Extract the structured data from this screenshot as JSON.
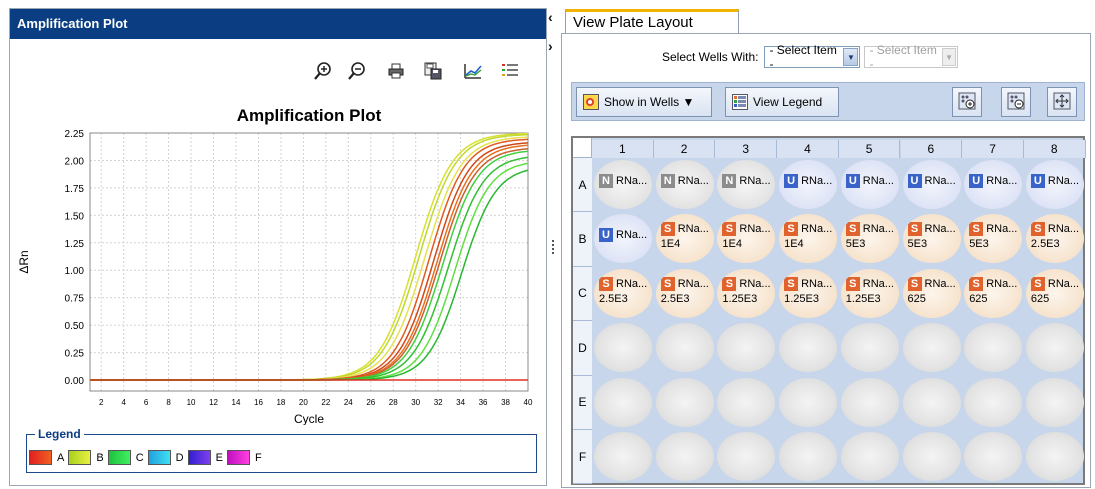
{
  "left_panel": {
    "title": "Amplification Plot",
    "toolbar_icons": [
      "zoom-in-icon",
      "zoom-out-icon",
      "print-icon",
      "save-icon",
      "plot-settings-icon",
      "legend-toggle-icon"
    ]
  },
  "legend": {
    "title": "Legend",
    "items": [
      {
        "label": "A",
        "color_from": "#e02020",
        "color_to": "#f06020"
      },
      {
        "label": "B",
        "color_from": "#a8d020",
        "color_to": "#e8f040"
      },
      {
        "label": "C",
        "color_from": "#20c040",
        "color_to": "#40f060"
      },
      {
        "label": "D",
        "color_from": "#20a0e0",
        "color_to": "#40e0f0"
      },
      {
        "label": "E",
        "color_from": "#3020d0",
        "color_to": "#8040f0"
      },
      {
        "label": "F",
        "color_from": "#c010c0",
        "color_to": "#ff40e0"
      }
    ]
  },
  "chart_data": {
    "type": "line",
    "title": "Amplification Plot",
    "xlabel": "Cycle",
    "ylabel": "ΔRn",
    "xlim": [
      1,
      40
    ],
    "ylim": [
      -0.1,
      2.25
    ],
    "x_ticks": [
      2,
      4,
      6,
      8,
      10,
      12,
      14,
      16,
      18,
      20,
      22,
      24,
      26,
      28,
      30,
      32,
      34,
      36,
      38,
      40
    ],
    "y_ticks": [
      "0.00",
      "0.25",
      "0.50",
      "0.75",
      "1.00",
      "1.25",
      "1.50",
      "1.75",
      "2.00",
      "2.25"
    ],
    "grid": true,
    "series": [
      {
        "color": "#d8e030",
        "midpoint": 30.0,
        "max": 2.25,
        "slope": 0.28
      },
      {
        "color": "#c0d830",
        "midpoint": 30.3,
        "max": 2.24,
        "slope": 0.28
      },
      {
        "color": "#e8e050",
        "midpoint": 30.8,
        "max": 2.22,
        "slope": 0.28
      },
      {
        "color": "#e05a20",
        "midpoint": 31.2,
        "max": 2.2,
        "slope": 0.29
      },
      {
        "color": "#d04818",
        "midpoint": 31.6,
        "max": 2.17,
        "slope": 0.29
      },
      {
        "color": "#e87020",
        "midpoint": 31.9,
        "max": 2.15,
        "slope": 0.29
      },
      {
        "color": "#c86030",
        "midpoint": 32.1,
        "max": 2.12,
        "slope": 0.29
      },
      {
        "color": "#40d040",
        "midpoint": 32.4,
        "max": 2.1,
        "slope": 0.29
      },
      {
        "color": "#30c030",
        "midpoint": 32.9,
        "max": 2.05,
        "slope": 0.29
      },
      {
        "color": "#60e040",
        "midpoint": 33.5,
        "max": 2.0,
        "slope": 0.3
      },
      {
        "color": "#28b830",
        "midpoint": 34.1,
        "max": 1.95,
        "slope": 0.3
      },
      {
        "color": "#e03020",
        "midpoint": 99,
        "max": 0,
        "slope": 0.3
      }
    ]
  },
  "right_panel": {
    "tab_label": "View Plate Layout",
    "select_label": "Select Wells With:",
    "select1_value": "- Select Item -",
    "select2_value": "- Select Item -",
    "show_in_wells_label": "Show in Wells ▼",
    "view_legend_label": "View Legend",
    "zoom_buttons": [
      "zoom-in-wells-icon",
      "zoom-out-wells-icon",
      "fit-wells-icon"
    ]
  },
  "plate": {
    "columns": [
      "1",
      "2",
      "3",
      "4",
      "5",
      "6",
      "7",
      "8"
    ],
    "rows": [
      "A",
      "B",
      "C",
      "D",
      "E",
      "F"
    ],
    "wells": {
      "A": [
        {
          "type": "N",
          "name": "RNa..."
        },
        {
          "type": "N",
          "name": "RNa..."
        },
        {
          "type": "N",
          "name": "RNa..."
        },
        {
          "type": "U",
          "name": "RNa..."
        },
        {
          "type": "U",
          "name": "RNa..."
        },
        {
          "type": "U",
          "name": "RNa..."
        },
        {
          "type": "U",
          "name": "RNa..."
        },
        {
          "type": "U",
          "name": "RNa..."
        }
      ],
      "B": [
        {
          "type": "U",
          "name": "RNa..."
        },
        {
          "type": "S",
          "name": "RNa...",
          "qty": "1E4"
        },
        {
          "type": "S",
          "name": "RNa...",
          "qty": "1E4"
        },
        {
          "type": "S",
          "name": "RNa...",
          "qty": "1E4"
        },
        {
          "type": "S",
          "name": "RNa...",
          "qty": "5E3"
        },
        {
          "type": "S",
          "name": "RNa...",
          "qty": "5E3"
        },
        {
          "type": "S",
          "name": "RNa...",
          "qty": "5E3"
        },
        {
          "type": "S",
          "name": "RNa...",
          "qty": "2.5E3"
        }
      ],
      "C": [
        {
          "type": "S",
          "name": "RNa...",
          "qty": "2.5E3"
        },
        {
          "type": "S",
          "name": "RNa...",
          "qty": "2.5E3"
        },
        {
          "type": "S",
          "name": "RNa...",
          "qty": "1.25E3"
        },
        {
          "type": "S",
          "name": "RNa...",
          "qty": "1.25E3"
        },
        {
          "type": "S",
          "name": "RNa...",
          "qty": "1.25E3"
        },
        {
          "type": "S",
          "name": "RNa...",
          "qty": "625"
        },
        {
          "type": "S",
          "name": "RNa...",
          "qty": "625"
        },
        {
          "type": "S",
          "name": "RNa...",
          "qty": "625"
        }
      ],
      "D": [
        {},
        {},
        {},
        {},
        {},
        {},
        {},
        {}
      ],
      "E": [
        {},
        {},
        {},
        {},
        {},
        {},
        {},
        {}
      ],
      "F": [
        {},
        {},
        {},
        {},
        {},
        {},
        {},
        {}
      ]
    }
  }
}
